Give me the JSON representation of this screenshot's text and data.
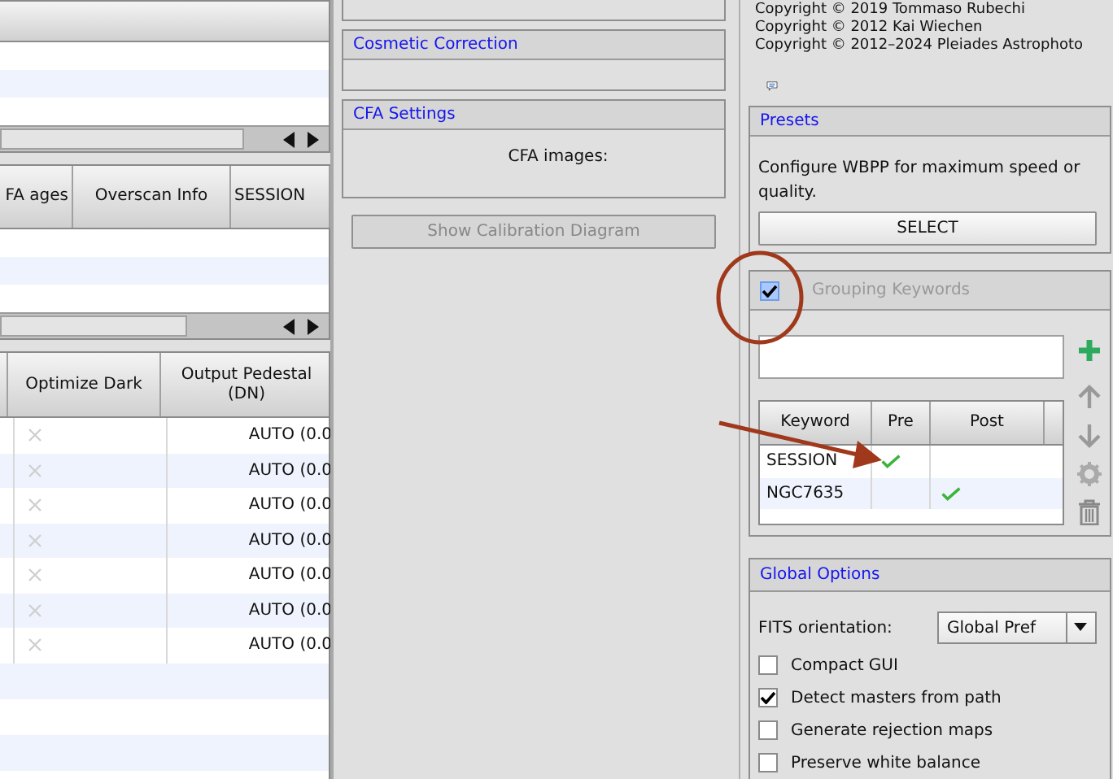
{
  "left": {
    "table_2": {
      "columns": [
        "FA ages",
        "Overscan Info",
        "SESSION"
      ]
    },
    "table_3": {
      "columns": [
        "Optimize Dark",
        "Output Pedestal (DN)"
      ],
      "rows": [
        {
          "optimize_dark": false,
          "output_pedestal": "AUTO (0.0"
        },
        {
          "optimize_dark": false,
          "output_pedestal": "AUTO (0.0"
        },
        {
          "optimize_dark": false,
          "output_pedestal": "AUTO (0.0"
        },
        {
          "optimize_dark": false,
          "output_pedestal": "AUTO (0.0"
        },
        {
          "optimize_dark": false,
          "output_pedestal": "AUTO (0.0"
        },
        {
          "optimize_dark": false,
          "output_pedestal": "AUTO (0.0"
        },
        {
          "optimize_dark": false,
          "output_pedestal": "AUTO (0.0"
        }
      ]
    }
  },
  "middle": {
    "panels": [
      {
        "title": "Cosmetic Correction"
      },
      {
        "title": "CFA Settings",
        "label": "CFA images:"
      }
    ],
    "button": {
      "label": "Show Calibration Diagram",
      "disabled": true
    }
  },
  "right": {
    "copyright": [
      "Copyright © 2019 Tommaso Rubechi",
      "Copyright © 2012 Kai Wiechen",
      "Copyright © 2012–2024 Pleiades Astrophoto"
    ],
    "presets": {
      "title": "Presets",
      "description": "Configure WBPP for maximum speed or quality.",
      "button": "SELECT"
    },
    "grouping": {
      "title": "Grouping Keywords",
      "checked": true,
      "columns": [
        "Keyword",
        "Pre",
        "Post"
      ],
      "rows": [
        {
          "keyword": "SESSION",
          "pre": true,
          "post": false
        },
        {
          "keyword": "NGC7635",
          "pre": false,
          "post": true
        }
      ]
    },
    "global_options": {
      "title": "Global Options",
      "fits_orientation": {
        "label": "FITS orientation:",
        "value": "Global Pref"
      },
      "options": [
        {
          "label": "Compact GUI",
          "checked": false
        },
        {
          "label": "Detect masters from path",
          "checked": true
        },
        {
          "label": "Generate rejection maps",
          "checked": false
        },
        {
          "label": "Preserve white balance",
          "checked": false
        }
      ]
    }
  }
}
